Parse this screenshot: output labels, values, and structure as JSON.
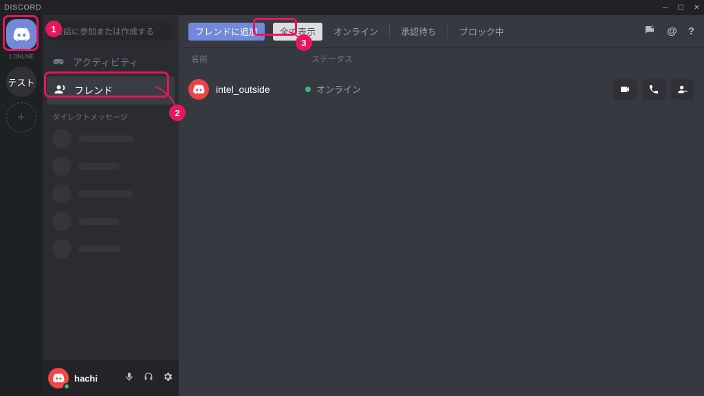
{
  "titlebar": {
    "title": "DISCORD"
  },
  "servers": {
    "home_label": "1 ONLINE",
    "test_label": "テスト"
  },
  "channels": {
    "search_placeholder": "会話に参加または作成する",
    "activity": "アクティビティ",
    "friends": "フレンド",
    "dm_header": "ダイレクトメッセージ"
  },
  "user": {
    "name": "hachi"
  },
  "topbar": {
    "add_friend": "フレンドに追加",
    "show_all": "全て表示",
    "tabs": [
      "オンライン",
      "承認待ち",
      "ブロック中"
    ]
  },
  "columns": {
    "name": "名前",
    "status": "ステータス"
  },
  "friends": [
    {
      "name": "intel_outside",
      "status": "オンライン"
    }
  ],
  "annotations": {
    "1": "1",
    "2": "2",
    "3": "3"
  }
}
